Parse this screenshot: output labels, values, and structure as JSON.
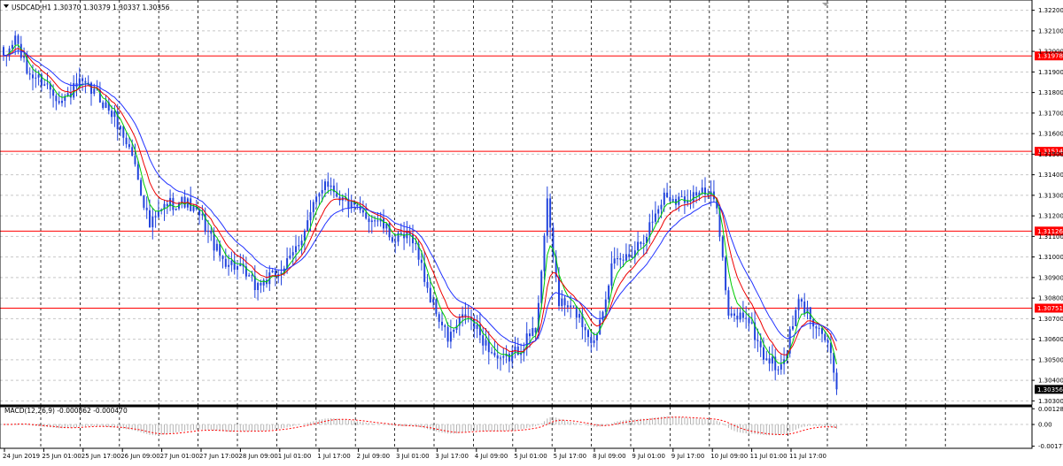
{
  "chart_data": [
    {
      "type": "candlestick",
      "header": "USDCAD,H1  1.30370 1.30379 1.30337 1.30356",
      "y_ticks": [
        "1.32200",
        "1.32100",
        "1.32000",
        "1.31900",
        "1.31800",
        "1.31700",
        "1.31600",
        "1.31500",
        "1.31400",
        "1.31300",
        "1.31200",
        "1.31100",
        "1.31000",
        "1.30900",
        "1.30800",
        "1.30700",
        "1.30600",
        "1.30500",
        "1.30400",
        "1.30300"
      ],
      "y_tick_values": [
        1.322,
        1.321,
        1.32,
        1.319,
        1.318,
        1.317,
        1.316,
        1.315,
        1.314,
        1.313,
        1.312,
        1.311,
        1.31,
        1.309,
        1.308,
        1.307,
        1.306,
        1.305,
        1.304,
        1.303
      ],
      "ylim": [
        1.3028,
        1.3225
      ],
      "x_labels": [
        "24 Jun 2019",
        "25 Jun 01:00",
        "25 Jun 17:00",
        "26 Jun 09:00",
        "27 Jun 01:00",
        "27 Jun 17:00",
        "28 Jun 09:00",
        "1 Jul 01:00",
        "1 Jul 17:00",
        "2 Jul 09:00",
        "3 Jul 01:00",
        "3 Jul 17:00",
        "4 Jul 09:00",
        "5 Jul 01:00",
        "5 Jul 17:00",
        "8 Jul 09:00",
        "9 Jul 01:00",
        "9 Jul 17:00",
        "10 Jul 09:00",
        "11 Jul 01:00",
        "11 Jul 17:00"
      ],
      "horizontal_levels": [
        {
          "label": "1.31978",
          "value": 1.31978,
          "color": "#ff0000"
        },
        {
          "label": "1.31514",
          "value": 1.31514,
          "color": "#ff0000"
        },
        {
          "label": "1.31126",
          "value": 1.31126,
          "color": "#ff0000"
        },
        {
          "label": "1.30751",
          "value": 1.30751,
          "color": "#ff0000"
        }
      ],
      "current_price": {
        "label": "1.30356",
        "value": 1.30356
      },
      "price_anchors": [
        [
          0,
          1.3195
        ],
        [
          4,
          1.3207
        ],
        [
          8,
          1.319
        ],
        [
          14,
          1.3185
        ],
        [
          20,
          1.3176
        ],
        [
          26,
          1.3184
        ],
        [
          32,
          1.3179
        ],
        [
          38,
          1.3168
        ],
        [
          44,
          1.315
        ],
        [
          50,
          1.3115
        ],
        [
          56,
          1.3126
        ],
        [
          62,
          1.3127
        ],
        [
          68,
          1.3118
        ],
        [
          74,
          1.31
        ],
        [
          80,
          1.3095
        ],
        [
          86,
          1.3086
        ],
        [
          92,
          1.309
        ],
        [
          98,
          1.3098
        ],
        [
          104,
          1.3117
        ],
        [
          110,
          1.3138
        ],
        [
          116,
          1.3128
        ],
        [
          122,
          1.3121
        ],
        [
          128,
          1.3118
        ],
        [
          134,
          1.3108
        ],
        [
          140,
          1.311
        ],
        [
          146,
          1.308
        ],
        [
          152,
          1.306
        ],
        [
          158,
          1.3072
        ],
        [
          164,
          1.306
        ],
        [
          170,
          1.3048
        ],
        [
          176,
          1.3055
        ],
        [
          182,
          1.3065
        ],
        [
          186,
          1.3125
        ],
        [
          190,
          1.3078
        ],
        [
          196,
          1.3073
        ],
        [
          202,
          1.3058
        ],
        [
          208,
          1.3095
        ],
        [
          214,
          1.3101
        ],
        [
          220,
          1.3112
        ],
        [
          226,
          1.313
        ],
        [
          232,
          1.3128
        ],
        [
          238,
          1.3132
        ],
        [
          244,
          1.3127
        ],
        [
          248,
          1.307
        ],
        [
          254,
          1.3072
        ],
        [
          260,
          1.3052
        ],
        [
          266,
          1.3045
        ],
        [
          272,
          1.3078
        ],
        [
          278,
          1.3068
        ],
        [
          282,
          1.3058
        ],
        [
          285,
          1.3036
        ]
      ],
      "colors": {
        "candles": "#2244dd",
        "ma_fast": "#00cc00",
        "ma_mid": "#ee0000",
        "ma_slow": "#2233ff",
        "grid": "#c8c8c8",
        "level": "#ff0000"
      }
    },
    {
      "type": "histogram",
      "header": "MACD(12,26,9) -0.000862 -0.000470",
      "y_ticks": [
        "0.001286",
        "0.00",
        "-0.001777"
      ],
      "y_tick_values": [
        0.001286,
        0.0,
        -0.001777
      ],
      "ylim": [
        -0.00195,
        0.00145
      ],
      "colors": {
        "histogram": "#b4b4b4",
        "signal": "#ff0000"
      }
    }
  ]
}
